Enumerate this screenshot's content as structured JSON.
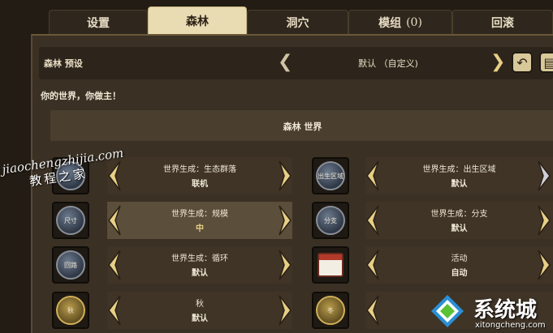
{
  "tabs": [
    {
      "label": "设置"
    },
    {
      "label": "森林",
      "active": true
    },
    {
      "label": "洞穴"
    },
    {
      "label": "模组",
      "count": "(0)"
    },
    {
      "label": "回滚"
    }
  ],
  "preset": {
    "label": "森林 预设",
    "value": "默认 （自定义)"
  },
  "tagline": "你的世界，你做主！",
  "section_title": "森林 世界",
  "settings_left": [
    {
      "name": "世界生成：生态群落",
      "value": "联机",
      "icon": "biome-icon",
      "icon_text": ""
    },
    {
      "name": "世界生成：规模",
      "value": "中",
      "icon": "size-icon",
      "icon_text": "尺寸"
    },
    {
      "name": "世界生成：循环",
      "value": "默认",
      "icon": "loop-icon",
      "icon_text": "回路"
    },
    {
      "name": "秋",
      "value": "默认",
      "icon": "autumn-icon",
      "icon_text": "秋"
    }
  ],
  "settings_right": [
    {
      "name": "世界生成：出生区域",
      "value": "默认",
      "icon": "spawn-area-icon",
      "icon_text": "出生区域"
    },
    {
      "name": "世界生成：分支",
      "value": "默认",
      "icon": "branches-icon",
      "icon_text": "分支"
    },
    {
      "name": "活动",
      "value": "自动",
      "icon": "calendar-icon",
      "icon_text": ""
    },
    {
      "name": "",
      "value": "",
      "icon": "season-icon",
      "icon_text": "冬"
    }
  ],
  "watermark": {
    "line1": "jiaochengzhijia.com",
    "line2": "教程之家",
    "brand": "系统城",
    "brand_sub": "xitongcheng.com"
  },
  "colors": {
    "background": "#231c14",
    "panel": "#3a3024",
    "active_tab": "#e9dcb3",
    "arrow": "#e6cf86",
    "text": "#f0e8d6"
  }
}
